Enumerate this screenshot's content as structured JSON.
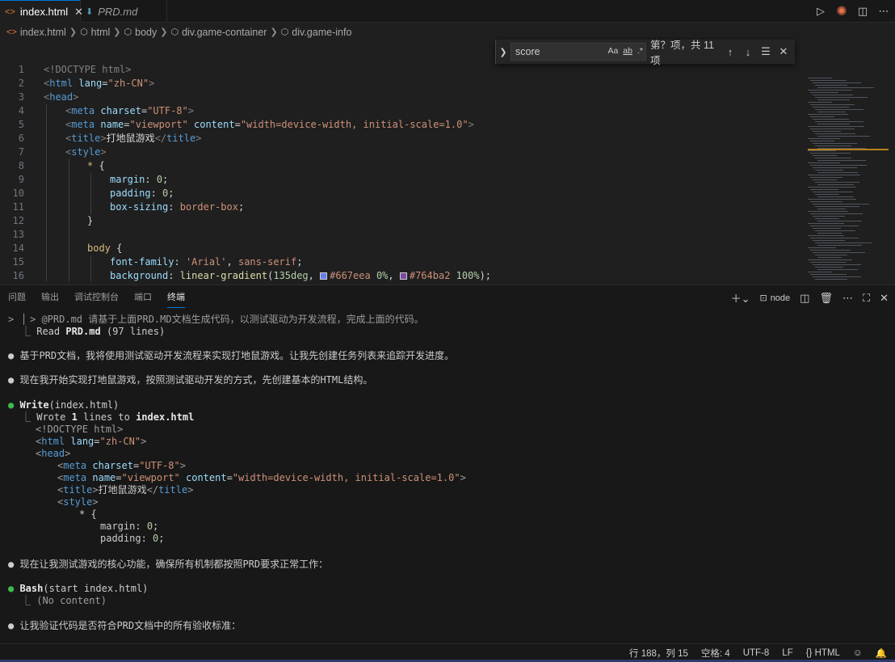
{
  "tabs": [
    {
      "label": "index.html",
      "icon": "html-file-icon",
      "active": true
    },
    {
      "label": "PRD.md",
      "icon": "markdown-file-icon",
      "active": false
    }
  ],
  "breadcrumb": [
    "index.html",
    "html",
    "body",
    "div.game-container",
    "div.game-info"
  ],
  "find": {
    "query": "score",
    "opt_case": "Aa",
    "opt_word": "ab",
    "opt_regex": ".*",
    "count": "第？项，共 11 项"
  },
  "code": [
    {
      "n": "1"
    },
    {
      "n": "2"
    },
    {
      "n": "3"
    },
    {
      "n": "4"
    },
    {
      "n": "5"
    },
    {
      "n": "6"
    },
    {
      "n": "7"
    },
    {
      "n": "8"
    },
    {
      "n": "9"
    },
    {
      "n": "10"
    },
    {
      "n": "11"
    },
    {
      "n": "12"
    },
    {
      "n": "13"
    },
    {
      "n": "14"
    },
    {
      "n": "15"
    },
    {
      "n": "16"
    }
  ],
  "code_text": {
    "l1_doctype": "<!DOCTYPE html>",
    "l2_tag": "html",
    "l2_attr": "lang",
    "l2_val": "\"zh-CN\"",
    "l3_tag": "head",
    "l4_tag": "meta",
    "l4_attr": "charset",
    "l4_val": "\"UTF-8\"",
    "l5_tag": "meta",
    "l5_attr1": "name",
    "l5_val1": "\"viewport\"",
    "l5_attr2": "content",
    "l5_val2": "\"width=device-width, initial-scale=1.0\"",
    "l6_tag": "title",
    "l6_text": "打地鼠游戏",
    "l7_tag": "style",
    "l8_sel": "*",
    "l9_prop": "margin",
    "l9_val": "0",
    "l10_prop": "padding",
    "l10_val": "0",
    "l11_prop": "box-sizing",
    "l11_val": "border-box",
    "l14_sel": "body",
    "l15_prop": "font-family",
    "l15_val1": "'Arial'",
    "l15_val2": "sans-serif",
    "l16_prop": "background",
    "l16_func": "linear-gradient",
    "l16_a": "135deg",
    "l16_c1": "#667eea",
    "l16_p1": "0%",
    "l16_c2": "#764ba2",
    "l16_p2": "100%"
  },
  "colors": {
    "c1": "#667eea",
    "c2": "#764ba2",
    "accent": "#0078d4"
  },
  "panel": {
    "tabs": [
      "问题",
      "输出",
      "调试控制台",
      "端口",
      "终端"
    ],
    "active_tab": "终端",
    "terminal_name": "node"
  },
  "terminal": {
    "prompt_line": "> @PRD.md 请基于上面PRD.MD文档生成代码，以测试驱动为开发流程，完成上面的代码。",
    "read_prefix": "Read ",
    "read_file": "PRD.md",
    "read_suffix": " (97 lines)",
    "msg1": "基于PRD文档，我将使用测试驱动开发流程来实现打地鼠游戏。让我先创建任务列表来追踪开发进度。",
    "msg2": "现在我开始实现打地鼠游戏，按照测试驱动开发的方式，先创建基本的HTML结构。",
    "write_tool": "Write",
    "write_arg": "(index.html)",
    "wrote_a": "Wrote ",
    "wrote_n": "1",
    "wrote_b": " lines to ",
    "wrote_file": "index.html",
    "w1": "<!DOCTYPE html>",
    "w2_tag": "html",
    "w2_attr": "lang",
    "w2_val": "\"zh-CN\"",
    "w3_tag": "head",
    "w4_tag": "meta",
    "w4_attr": "charset",
    "w4_val": "\"UTF-8\"",
    "w5_tag": "meta",
    "w5_attr1": "name",
    "w5_val1": "\"viewport\"",
    "w5_attr2": "content",
    "w5_val2": "\"width=device-width, initial-scale=1.0\"",
    "w6_tag": "title",
    "w6_text": "打地鼠游戏",
    "w7_tag": "style",
    "w8": "* {",
    "w9_prop": "margin:",
    "w9_val": "0",
    "w10_prop": "padding:",
    "w10_val": "0",
    "msg3": "现在让我测试游戏的核心功能，确保所有机制都按照PRD要求正常工作：",
    "bash_tool": "Bash",
    "bash_arg": "(start index.html)",
    "bash_result": "(No content)",
    "msg4": "让我验证代码是否符合PRD文档中的所有验收标准："
  },
  "status": {
    "position": "行 188，列 15",
    "spaces": "空格: 4",
    "encoding": "UTF-8",
    "eol": "LF",
    "language": "HTML"
  }
}
